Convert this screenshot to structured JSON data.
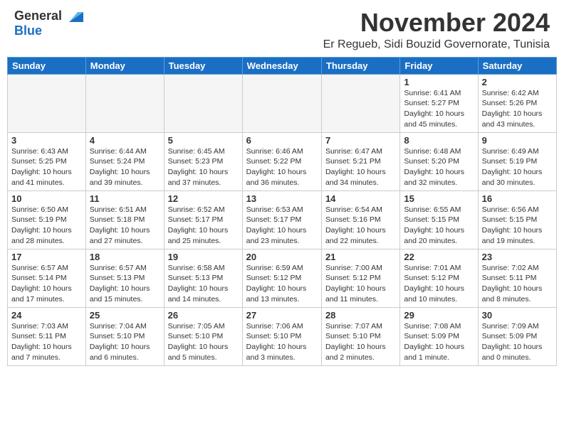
{
  "header": {
    "logo_general": "General",
    "logo_blue": "Blue",
    "month_title": "November 2024",
    "location": "Er Regueb, Sidi Bouzid Governorate, Tunisia"
  },
  "calendar": {
    "days_of_week": [
      "Sunday",
      "Monday",
      "Tuesday",
      "Wednesday",
      "Thursday",
      "Friday",
      "Saturday"
    ],
    "weeks": [
      [
        {
          "day": "",
          "empty": true
        },
        {
          "day": "",
          "empty": true
        },
        {
          "day": "",
          "empty": true
        },
        {
          "day": "",
          "empty": true
        },
        {
          "day": "",
          "empty": true
        },
        {
          "day": "1",
          "sunrise": "6:41 AM",
          "sunset": "5:27 PM",
          "daylight": "10 hours and 45 minutes."
        },
        {
          "day": "2",
          "sunrise": "6:42 AM",
          "sunset": "5:26 PM",
          "daylight": "10 hours and 43 minutes."
        }
      ],
      [
        {
          "day": "3",
          "sunrise": "6:43 AM",
          "sunset": "5:25 PM",
          "daylight": "10 hours and 41 minutes."
        },
        {
          "day": "4",
          "sunrise": "6:44 AM",
          "sunset": "5:24 PM",
          "daylight": "10 hours and 39 minutes."
        },
        {
          "day": "5",
          "sunrise": "6:45 AM",
          "sunset": "5:23 PM",
          "daylight": "10 hours and 37 minutes."
        },
        {
          "day": "6",
          "sunrise": "6:46 AM",
          "sunset": "5:22 PM",
          "daylight": "10 hours and 36 minutes."
        },
        {
          "day": "7",
          "sunrise": "6:47 AM",
          "sunset": "5:21 PM",
          "daylight": "10 hours and 34 minutes."
        },
        {
          "day": "8",
          "sunrise": "6:48 AM",
          "sunset": "5:20 PM",
          "daylight": "10 hours and 32 minutes."
        },
        {
          "day": "9",
          "sunrise": "6:49 AM",
          "sunset": "5:19 PM",
          "daylight": "10 hours and 30 minutes."
        }
      ],
      [
        {
          "day": "10",
          "sunrise": "6:50 AM",
          "sunset": "5:19 PM",
          "daylight": "10 hours and 28 minutes."
        },
        {
          "day": "11",
          "sunrise": "6:51 AM",
          "sunset": "5:18 PM",
          "daylight": "10 hours and 27 minutes."
        },
        {
          "day": "12",
          "sunrise": "6:52 AM",
          "sunset": "5:17 PM",
          "daylight": "10 hours and 25 minutes."
        },
        {
          "day": "13",
          "sunrise": "6:53 AM",
          "sunset": "5:17 PM",
          "daylight": "10 hours and 23 minutes."
        },
        {
          "day": "14",
          "sunrise": "6:54 AM",
          "sunset": "5:16 PM",
          "daylight": "10 hours and 22 minutes."
        },
        {
          "day": "15",
          "sunrise": "6:55 AM",
          "sunset": "5:15 PM",
          "daylight": "10 hours and 20 minutes."
        },
        {
          "day": "16",
          "sunrise": "6:56 AM",
          "sunset": "5:15 PM",
          "daylight": "10 hours and 19 minutes."
        }
      ],
      [
        {
          "day": "17",
          "sunrise": "6:57 AM",
          "sunset": "5:14 PM",
          "daylight": "10 hours and 17 minutes."
        },
        {
          "day": "18",
          "sunrise": "6:57 AM",
          "sunset": "5:13 PM",
          "daylight": "10 hours and 15 minutes."
        },
        {
          "day": "19",
          "sunrise": "6:58 AM",
          "sunset": "5:13 PM",
          "daylight": "10 hours and 14 minutes."
        },
        {
          "day": "20",
          "sunrise": "6:59 AM",
          "sunset": "5:12 PM",
          "daylight": "10 hours and 13 minutes."
        },
        {
          "day": "21",
          "sunrise": "7:00 AM",
          "sunset": "5:12 PM",
          "daylight": "10 hours and 11 minutes."
        },
        {
          "day": "22",
          "sunrise": "7:01 AM",
          "sunset": "5:12 PM",
          "daylight": "10 hours and 10 minutes."
        },
        {
          "day": "23",
          "sunrise": "7:02 AM",
          "sunset": "5:11 PM",
          "daylight": "10 hours and 8 minutes."
        }
      ],
      [
        {
          "day": "24",
          "sunrise": "7:03 AM",
          "sunset": "5:11 PM",
          "daylight": "10 hours and 7 minutes."
        },
        {
          "day": "25",
          "sunrise": "7:04 AM",
          "sunset": "5:10 PM",
          "daylight": "10 hours and 6 minutes."
        },
        {
          "day": "26",
          "sunrise": "7:05 AM",
          "sunset": "5:10 PM",
          "daylight": "10 hours and 5 minutes."
        },
        {
          "day": "27",
          "sunrise": "7:06 AM",
          "sunset": "5:10 PM",
          "daylight": "10 hours and 3 minutes."
        },
        {
          "day": "28",
          "sunrise": "7:07 AM",
          "sunset": "5:10 PM",
          "daylight": "10 hours and 2 minutes."
        },
        {
          "day": "29",
          "sunrise": "7:08 AM",
          "sunset": "5:09 PM",
          "daylight": "10 hours and 1 minute."
        },
        {
          "day": "30",
          "sunrise": "7:09 AM",
          "sunset": "5:09 PM",
          "daylight": "10 hours and 0 minutes."
        }
      ]
    ]
  }
}
